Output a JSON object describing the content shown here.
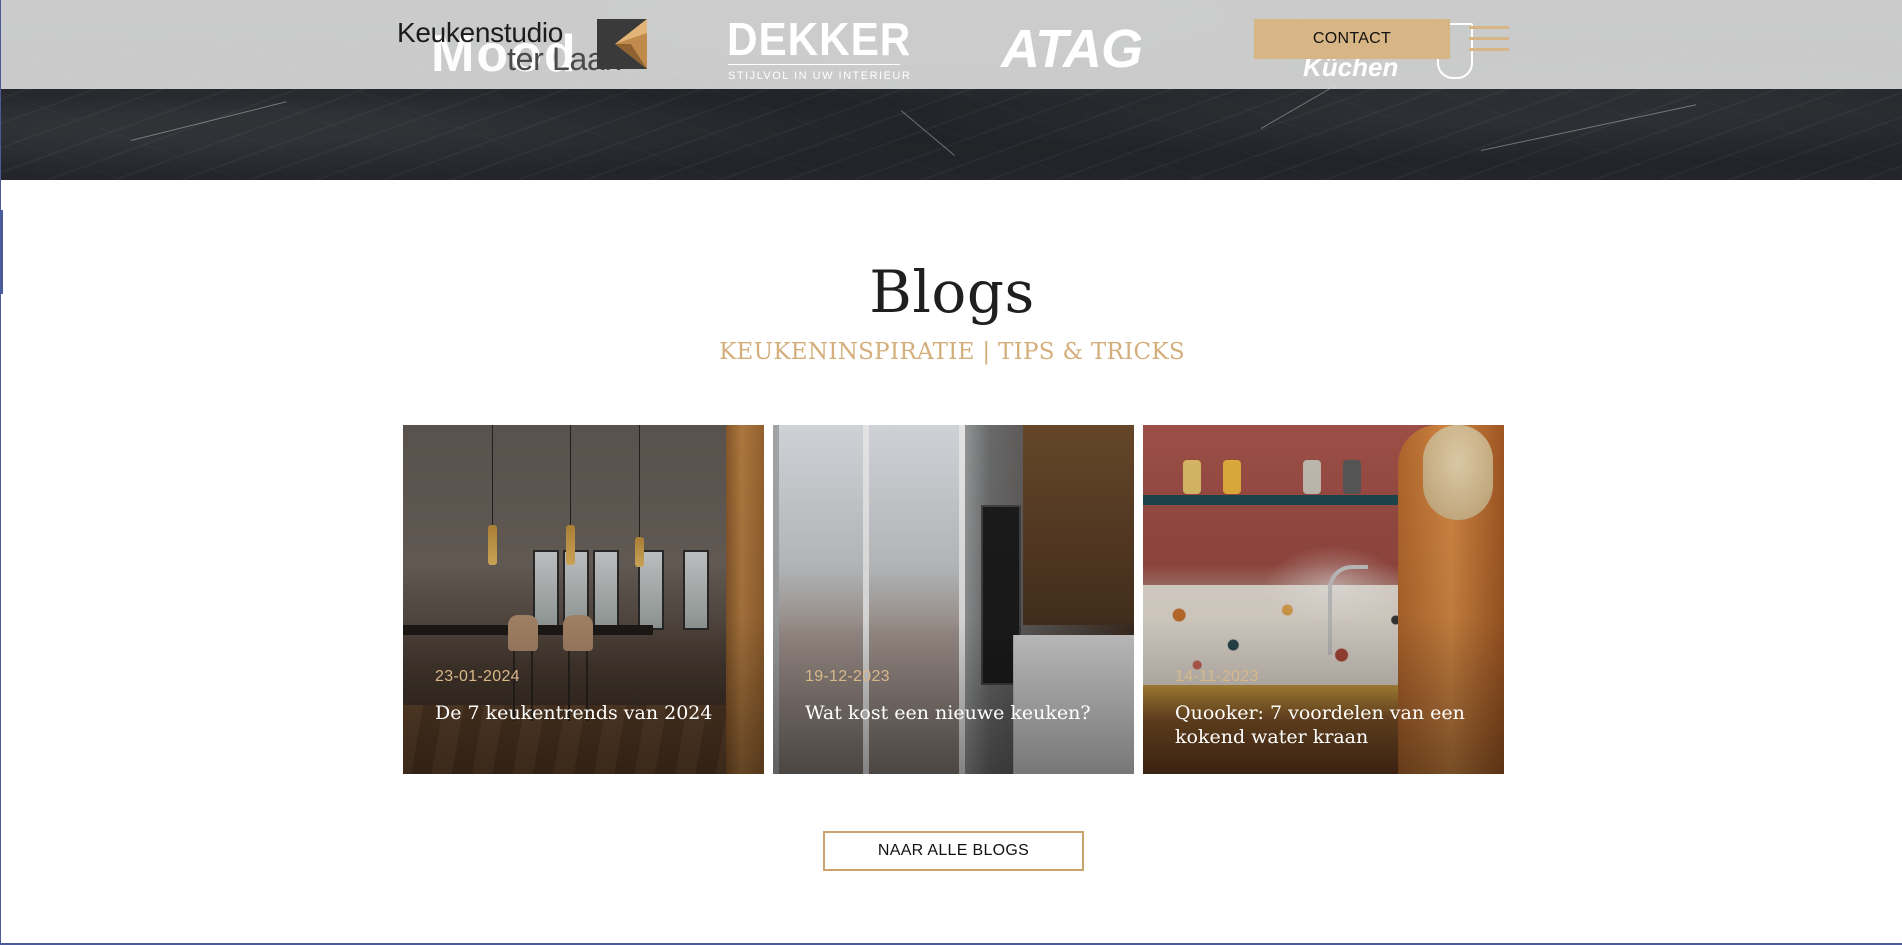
{
  "header": {
    "logo": {
      "line1": "Keukenstudio",
      "line2": "ter Laak",
      "colors": {
        "dark": "#3a3a3a",
        "accent": "#b9874a"
      }
    },
    "contact_label": "CONTACT",
    "menu_icon": "hamburger-menu-icon",
    "brand_logos": {
      "mood": "Mood",
      "dekker": "DEKKER",
      "dekker_tagline": "STIJLVOL IN UW INTERIEUR",
      "atag": "ATAG",
      "kuchen": "Küchen"
    }
  },
  "section": {
    "title": "Blogs",
    "subtitle": "KEUKENINSPIRATIE | TIPS & TRICKS"
  },
  "blogs": [
    {
      "date": "23-01-2024",
      "title": "De 7 keukentrends van 2024"
    },
    {
      "date": "19-12-2023",
      "title": "Wat kost een nieuwe keuken?"
    },
    {
      "date": "14-11-2023",
      "title": "Quooker: 7 voordelen van een kokend water kraan"
    }
  ],
  "cta": {
    "label": "NAAR ALLE BLOGS"
  },
  "colors": {
    "accent": "#d8b584",
    "subtitle": "#d4ae7b",
    "date": "#d9b88a",
    "hero": "#23252a"
  }
}
